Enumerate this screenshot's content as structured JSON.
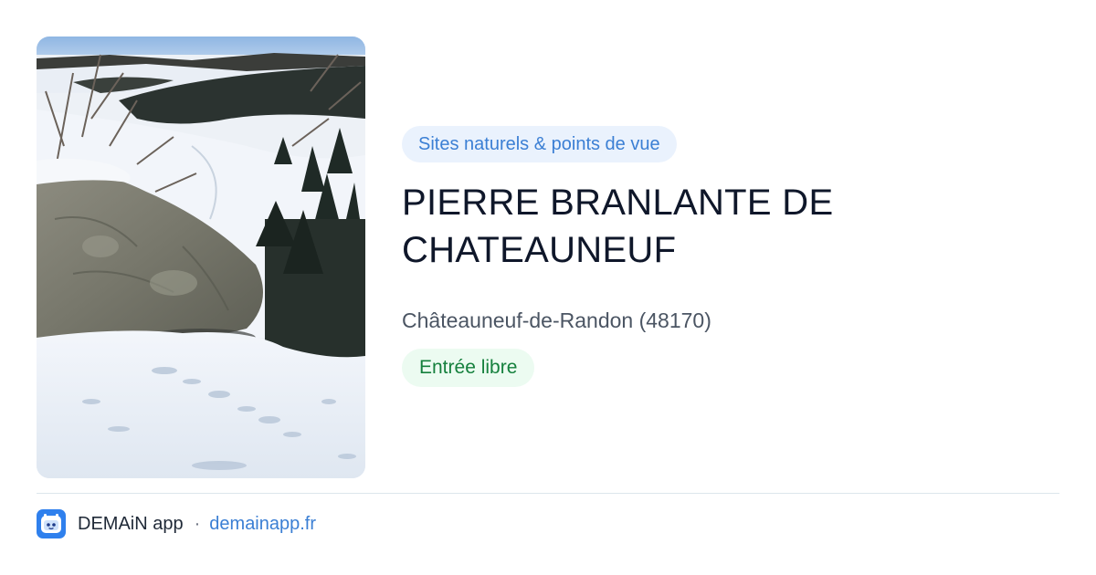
{
  "photo": {
    "alt": "Rocher enneigé avec vue sur la vallée en hiver"
  },
  "place": {
    "category": "Sites naturels & points de vue",
    "title": "PIERRE BRANLANTE DE CHATEAUNEUF",
    "location": "Châteauneuf-de-Randon (48170)",
    "price": "Entrée libre"
  },
  "footer": {
    "app_icon": "demain-logo-icon",
    "app_name": "DEMAiN app",
    "separator": "·",
    "link": "demainapp.fr"
  },
  "colors": {
    "accent_blue": "#3b7fd4",
    "category_bg": "#eaf2fd",
    "price_green": "#15803d",
    "price_bg": "#ecfbf1",
    "title": "#0f172a",
    "location": "#4b5563",
    "divider": "#dde6ec",
    "app_icon_bg": "#2f80ed"
  }
}
